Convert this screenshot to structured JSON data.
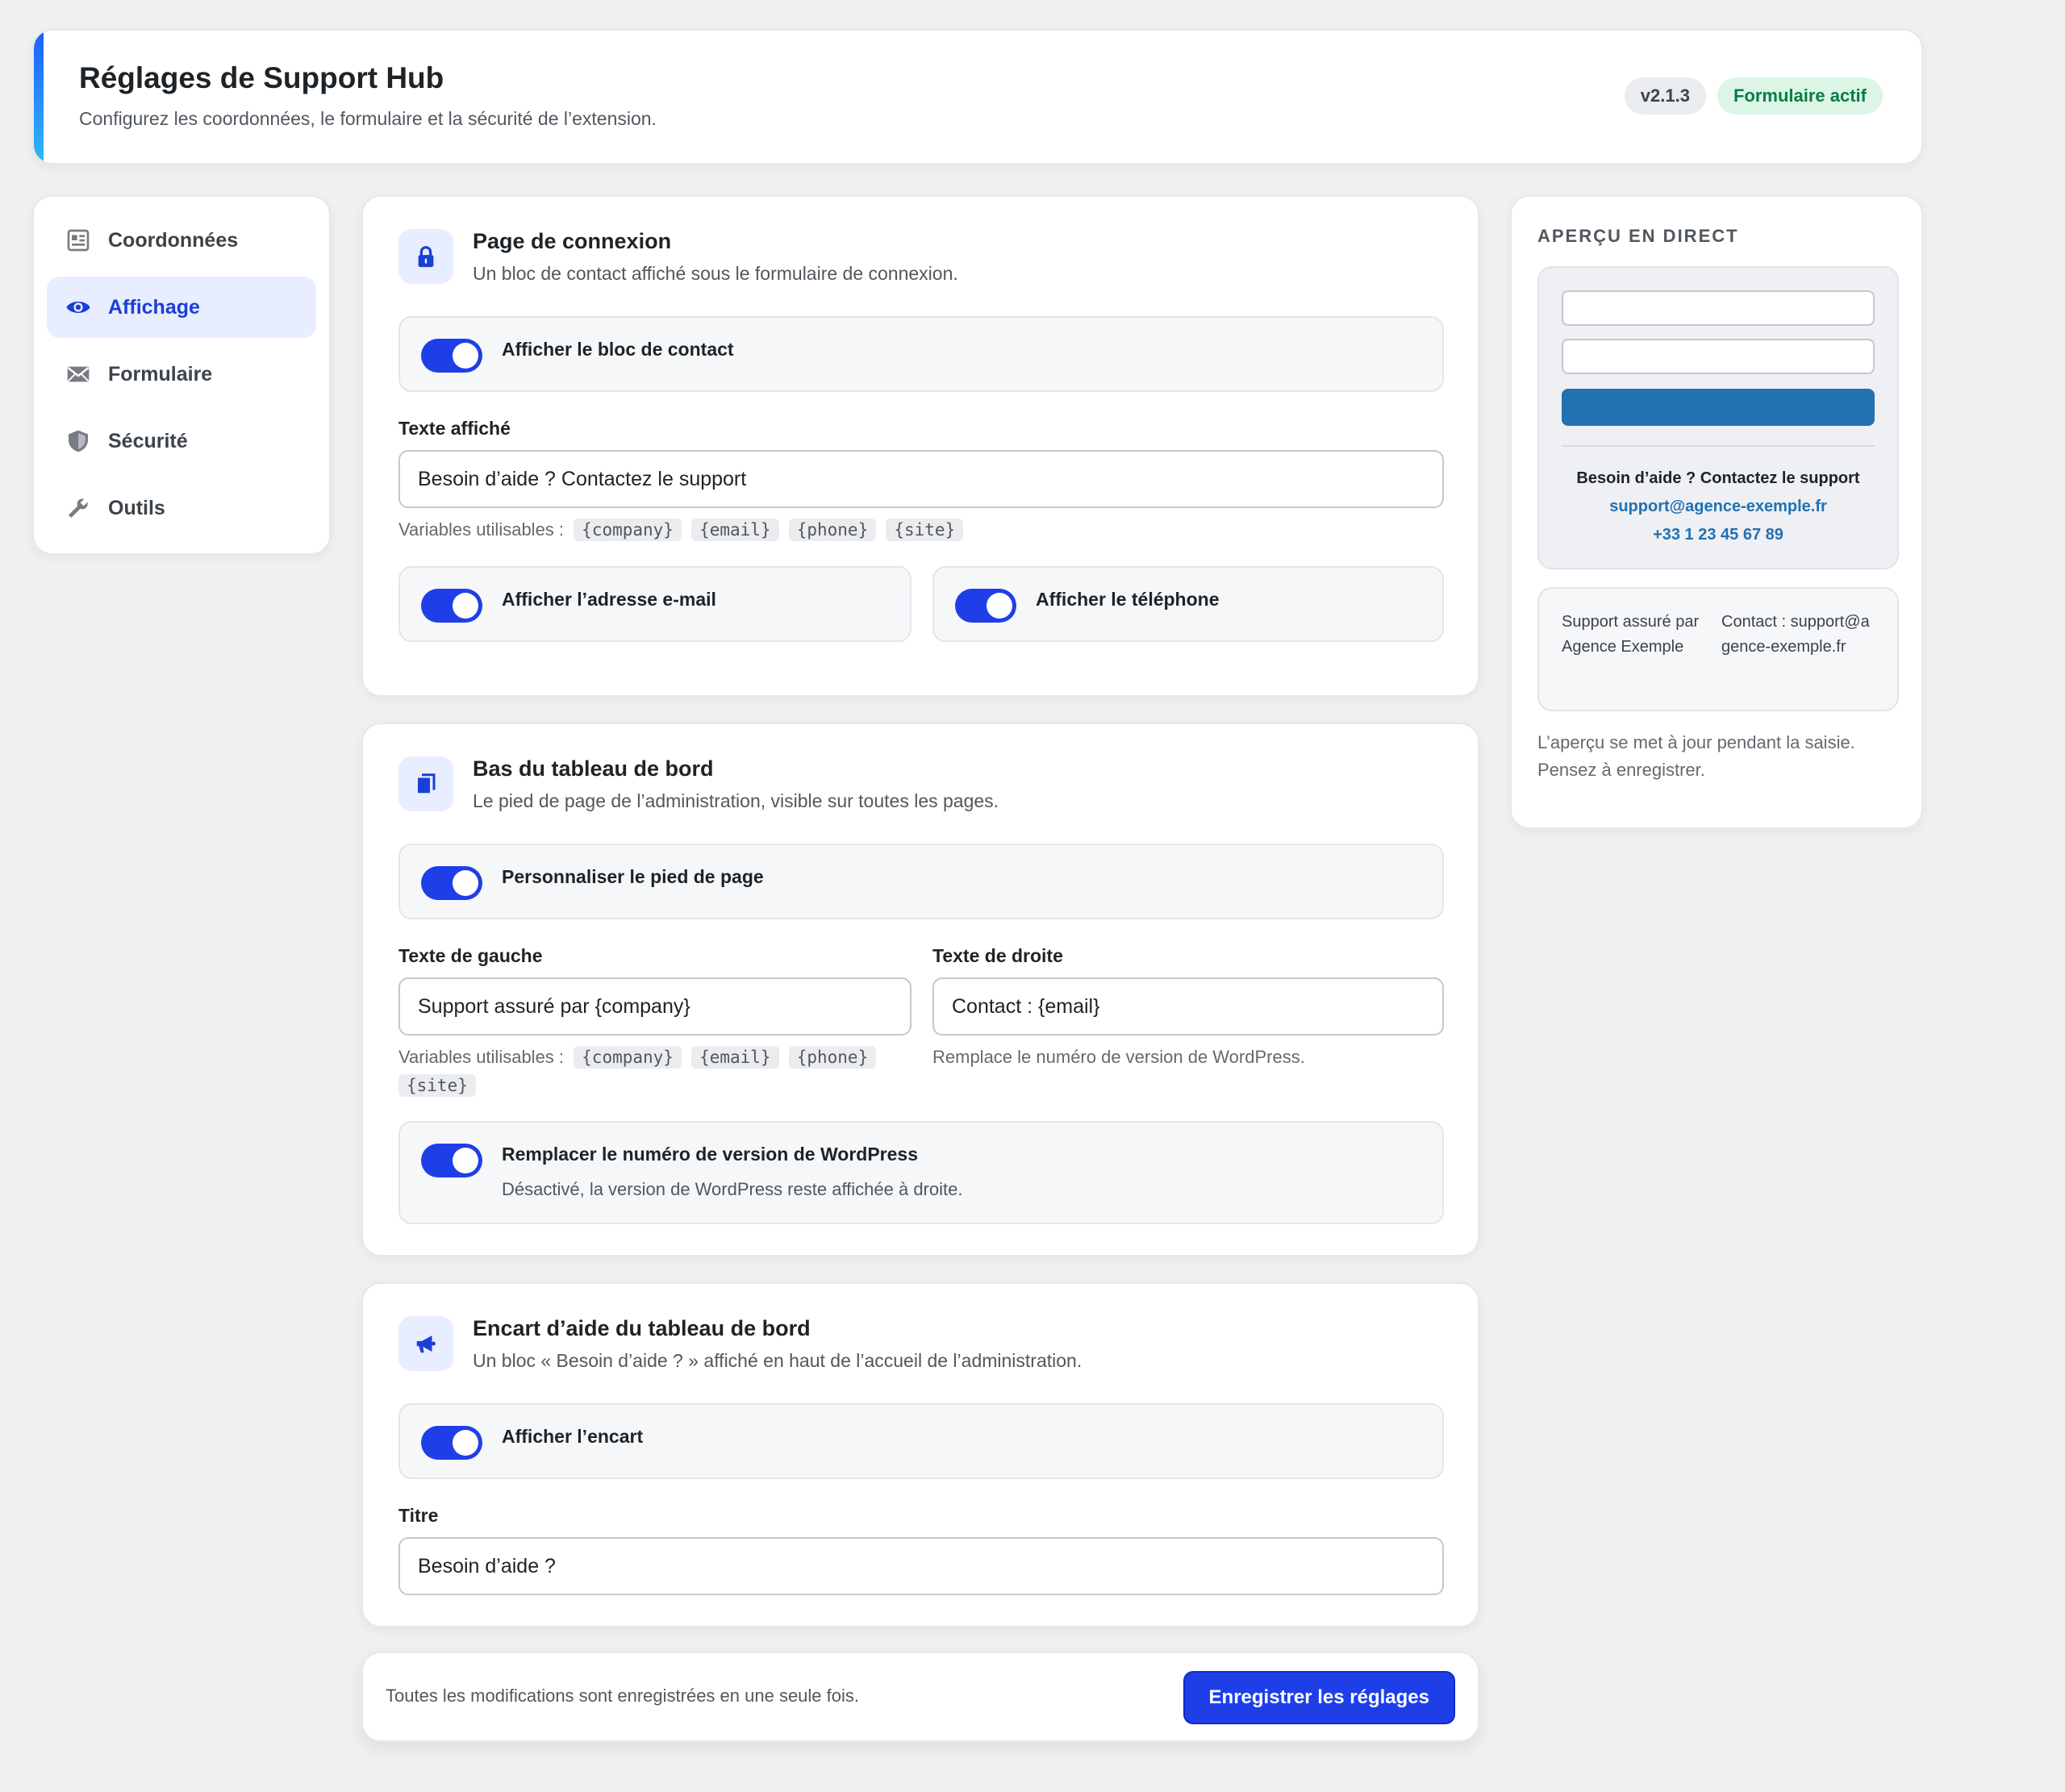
{
  "header": {
    "title": "Réglages de Support Hub",
    "subtitle": "Configurez les coordonnées, le formulaire et la sécurité de l’extension.",
    "version_badge": "v2.1.3",
    "status_badge": "Formulaire actif",
    "accent_color": "#1e5eff"
  },
  "sidebar": {
    "items": [
      {
        "label": "Coordonnées",
        "icon": "id-card-icon",
        "active": false
      },
      {
        "label": "Affichage",
        "icon": "eye-icon",
        "active": true
      },
      {
        "label": "Formulaire",
        "icon": "envelope-icon",
        "active": false
      },
      {
        "label": "Sécurité",
        "icon": "shield-icon",
        "active": false
      },
      {
        "label": "Outils",
        "icon": "wrench-icon",
        "active": false
      }
    ]
  },
  "sections": {
    "login": {
      "title": "Page de connexion",
      "description": "Un bloc de contact affiché sous le formulaire de connexion.",
      "icon": "lock-icon",
      "toggle_contact": {
        "label": "Afficher le bloc de contact",
        "on": true
      },
      "text_label": "Texte affiché",
      "text_value": "Besoin d’aide ? Contactez le support",
      "vars_label": "Variables utilisables :",
      "vars": [
        "{company}",
        "{email}",
        "{phone}",
        "{site}"
      ],
      "toggle_email": {
        "label": "Afficher l’adresse e-mail",
        "on": true
      },
      "toggle_phone": {
        "label": "Afficher le téléphone",
        "on": true
      }
    },
    "footer": {
      "title": "Bas du tableau de bord",
      "description": "Le pied de page de l’administration, visible sur toutes les pages.",
      "icon": "copy-icon",
      "toggle_custom": {
        "label": "Personnaliser le pied de page",
        "on": true
      },
      "left_label": "Texte de gauche",
      "left_value": "Support assuré par {company}",
      "right_label": "Texte de droite",
      "right_value": "Contact : {email}",
      "vars_label": "Variables utilisables :",
      "vars": [
        "{company}",
        "{email}",
        "{phone}",
        "{site}"
      ],
      "right_help": "Remplace le numéro de version de WordPress.",
      "toggle_version": {
        "label": "Remplacer le numéro de version de WordPress",
        "sub": "Désactivé, la version de WordPress reste affichée à droite.",
        "on": true
      }
    },
    "help": {
      "title": "Encart d’aide du tableau de bord",
      "description": "Un bloc « Besoin d’aide ? » affiché en haut de l’accueil de l’administration.",
      "icon": "megaphone-icon",
      "toggle_show": {
        "label": "Afficher l’encart",
        "on": true
      },
      "title_label": "Titre",
      "title_value": "Besoin d’aide ?"
    }
  },
  "savebar": {
    "text": "Toutes les modifications sont enregistrées en une seule fois.",
    "button": "Enregistrer les réglages"
  },
  "preview": {
    "heading": "APERÇU EN DIRECT",
    "contact_title": "Besoin d’aide ? Contactez le support",
    "contact_email": "support@agence-exemple.fr",
    "contact_phone": "+33 1 23 45 67 89",
    "footer_left": "Support assuré par Agence Exemple",
    "footer_right": "Contact : support@agence-exemple.fr",
    "note": "L’aperçu se met à jour pendant la saisie. Pensez à enregistrer."
  }
}
